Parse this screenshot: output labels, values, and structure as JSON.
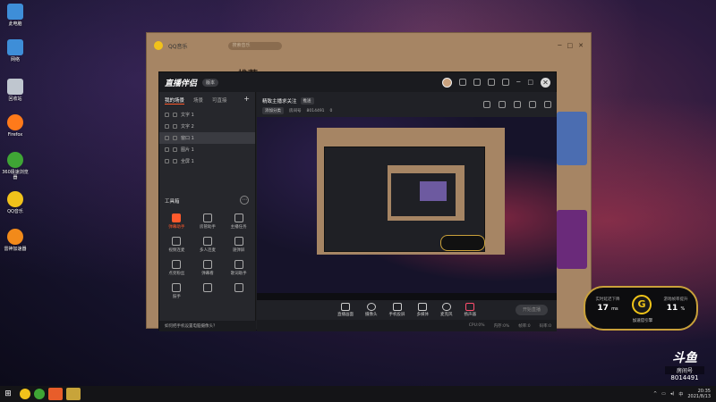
{
  "desktop": {
    "icons": [
      {
        "label": "此电脑",
        "color": "#3e8ed8"
      },
      {
        "label": "网络",
        "color": "#3e8ed8"
      },
      {
        "label": "回收站",
        "color": "#bfc6cf"
      },
      {
        "label": "Firefox",
        "color": "#ff7a1a"
      },
      {
        "label": "360极速浏览器",
        "color": "#3fa535"
      },
      {
        "label": "QQ音乐",
        "color": "#f1c21b"
      },
      {
        "label": "雷神加速器",
        "color": "#f28a1a"
      }
    ]
  },
  "qq_music": {
    "title": "QQ音乐",
    "search_placeholder": "搜索音乐",
    "heading": "推荐",
    "window_buttons": [
      "─",
      "□",
      "✕"
    ]
  },
  "live": {
    "logo": "直播伴侣",
    "version_badge": "版本",
    "header_controls": [
      "─",
      "□"
    ],
    "close": "✕",
    "tabs": [
      "我的场景",
      "场景",
      "可直接"
    ],
    "scenes": [
      {
        "label": "文字 1"
      },
      {
        "label": "文字 2"
      },
      {
        "label": "窗口 1"
      },
      {
        "label": "图片 1"
      },
      {
        "label": "全屏 1"
      }
    ],
    "tools_title": "工具箱",
    "tools_more": "⋯",
    "tools": [
      {
        "label": "弹幕助手",
        "accent": true
      },
      {
        "label": "房管助手",
        "accent": false
      },
      {
        "label": "主播任务",
        "accent": false
      },
      {
        "label": "视频连麦",
        "accent": false
      },
      {
        "label": "多人连麦",
        "accent": false
      },
      {
        "label": "速弹屏",
        "accent": false
      },
      {
        "label": "点亮粉丝",
        "accent": false
      },
      {
        "label": "弹幕看",
        "accent": false
      },
      {
        "label": "歌词助手",
        "accent": false
      },
      {
        "label": "鼓手",
        "accent": false
      },
      {
        "label": "",
        "accent": false
      },
      {
        "label": "",
        "accent": false
      }
    ],
    "hint": "如何把手机设置电脑摄像头？",
    "room": {
      "title": "精致主播求关注",
      "tag": "推送",
      "category_chip": "添加分类",
      "room_id_label": "房间号",
      "room_id": "8014491",
      "fans_count": "0"
    },
    "bottom_actions": [
      "直播画面",
      "摄像头",
      "手机投屏",
      "多媒体",
      "麦克风",
      "扬声器"
    ],
    "start_button": "开始直播",
    "stats": [
      "CPU:0%",
      "内存:0%",
      "帧率:0",
      "码率:0"
    ]
  },
  "speed_widget": {
    "left_title": "实时延迟下降",
    "left_value": "17",
    "left_unit": "ms",
    "center_glyph": "G",
    "caption": "加速官引擎",
    "right_title": "游戏帧率提升",
    "right_value": "11",
    "right_unit": "%"
  },
  "room_mark": {
    "brand": "斗鱼",
    "sub": "房间号",
    "number": "8014491"
  },
  "taskbar": {
    "start": "⊞",
    "apps": [
      {
        "name": "qq-music",
        "color": "#f1c21b"
      },
      {
        "name": "browser-360",
        "color": "#3fa535"
      },
      {
        "name": "live-companion",
        "color": "#e85d2a"
      },
      {
        "name": "douyu-app",
        "color": "#c8a43a"
      }
    ],
    "time": "20:35",
    "date": "2021/8/13"
  }
}
